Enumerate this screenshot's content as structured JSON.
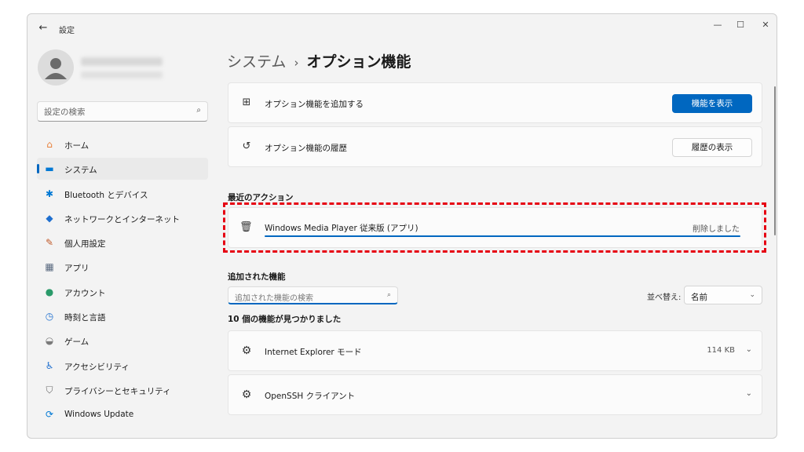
{
  "window": {
    "app_title": "設定",
    "back_icon": "←",
    "minimize_icon": "—",
    "maximize_icon": "☐",
    "close_icon": "✕"
  },
  "sidebar": {
    "search_placeholder": "設定の検索",
    "search_icon": "⌕",
    "items": [
      {
        "label": "ホーム",
        "icon": "home-icon",
        "glyph": "⌂",
        "color": "#e8803a",
        "selected": false
      },
      {
        "label": "システム",
        "icon": "system-icon",
        "glyph": "▬",
        "color": "#0078d4",
        "selected": true
      },
      {
        "label": "Bluetooth とデバイス",
        "icon": "bluetooth-icon",
        "glyph": "✱",
        "color": "#0078d4",
        "selected": false
      },
      {
        "label": "ネットワークとインターネット",
        "icon": "wifi-icon",
        "glyph": "◆",
        "color": "#1f6fcf",
        "selected": false
      },
      {
        "label": "個人用設定",
        "icon": "brush-icon",
        "glyph": "✎",
        "color": "#c05a2a",
        "selected": false
      },
      {
        "label": "アプリ",
        "icon": "apps-icon",
        "glyph": "▦",
        "color": "#5a6a80",
        "selected": false
      },
      {
        "label": "アカウント",
        "icon": "account-icon",
        "glyph": "●",
        "color": "#2a9a6a",
        "selected": false
      },
      {
        "label": "時刻と言語",
        "icon": "clock-globe-icon",
        "glyph": "◷",
        "color": "#1f6fcf",
        "selected": false
      },
      {
        "label": "ゲーム",
        "icon": "gamepad-icon",
        "glyph": "◒",
        "color": "#7a7a7a",
        "selected": false
      },
      {
        "label": "アクセシビリティ",
        "icon": "accessibility-icon",
        "glyph": "♿",
        "color": "#1f6fcf",
        "selected": false
      },
      {
        "label": "プライバシーとセキュリティ",
        "icon": "shield-icon",
        "glyph": "⛉",
        "color": "#6a6a6a",
        "selected": false
      },
      {
        "label": "Windows Update",
        "icon": "windows-update-icon",
        "glyph": "⟳",
        "color": "#0078d4",
        "selected": false
      }
    ]
  },
  "breadcrumb": {
    "parent": "システム",
    "separator": "›",
    "current": "オプション機能"
  },
  "add_feature": {
    "label": "オプション機能を追加する",
    "icon_glyph": "⊞",
    "button": "機能を表示"
  },
  "history": {
    "label": "オプション機能の履歴",
    "icon_glyph": "↺",
    "button": "履歴の表示"
  },
  "recent_actions": {
    "title": "最近のアクション",
    "item": {
      "label": "Windows Media Player 従来版 (アプリ)",
      "status": "削除しました",
      "icon_glyph": "🗑",
      "progress": 1.0
    }
  },
  "added_features": {
    "title": "追加された機能",
    "search_placeholder": "追加された機能の検索",
    "search_icon": "⌕",
    "sort_label": "並べ替え:",
    "sort_value": "名前",
    "sort_chevron": "⌄",
    "count_text": "10 個の機能が見つかりました",
    "items": [
      {
        "name": "Internet Explorer モード",
        "size": "114 KB",
        "icon_glyph": "⚙"
      },
      {
        "name": "OpenSSH クライアント",
        "size": "",
        "icon_glyph": "⚙"
      }
    ]
  },
  "colors": {
    "accent": "#0067c0",
    "highlight": "#e60012"
  }
}
